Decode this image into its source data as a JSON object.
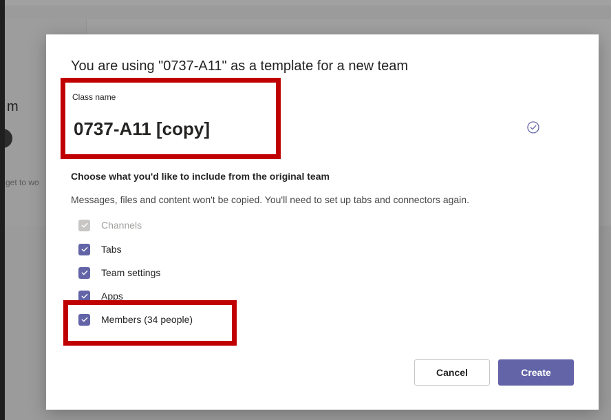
{
  "background": {
    "partial_text": "m",
    "partial_text_2": "get to wo"
  },
  "dialog": {
    "title": "You are using \"0737-A11\" as a template for a new team",
    "class_name_label": "Class name",
    "class_name_value": "0737-A11 [copy]",
    "validation_icon": "check-circle-icon",
    "include_heading": "Choose what you'd like to include from the original team",
    "include_description": "Messages, files and content won't be copied. You'll need to set up tabs and connectors again.",
    "options": [
      {
        "label": "Channels",
        "checked": true,
        "disabled": true
      },
      {
        "label": "Tabs",
        "checked": true,
        "disabled": false
      },
      {
        "label": "Team settings",
        "checked": true,
        "disabled": false
      },
      {
        "label": "Apps",
        "checked": true,
        "disabled": false
      },
      {
        "label": "Members (34 people)",
        "checked": true,
        "disabled": false
      }
    ],
    "cancel_label": "Cancel",
    "create_label": "Create"
  },
  "colors": {
    "accent": "#6264a7",
    "highlight": "#c00000",
    "disabled_checkbox": "#c8c6c4"
  }
}
